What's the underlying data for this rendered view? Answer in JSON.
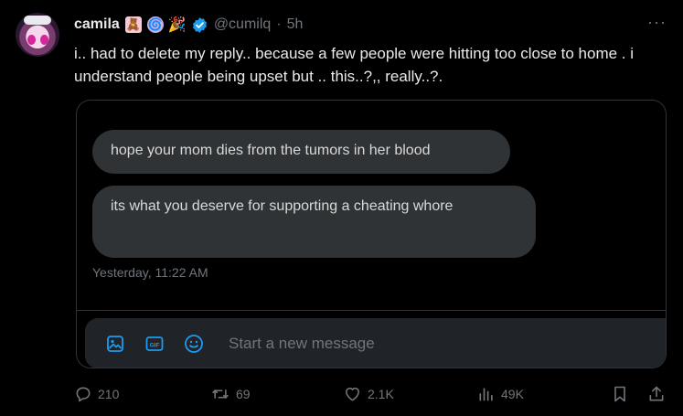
{
  "author": {
    "name": "camila",
    "handle": "@cumilq",
    "separator": "·",
    "time": "5h",
    "emoji": [
      "🧸",
      "🌀",
      "🎉"
    ],
    "verified_color": "#1d9bf0"
  },
  "tweet": {
    "text": "i.. had to delete my reply.. because a few people were hitting too close to home . i understand people being upset but .. this..?,, really..?."
  },
  "dm_screenshot": {
    "messages": [
      "hope your mom dies from the tumors in her blood",
      "its what you deserve for supporting a cheating whore"
    ],
    "timestamp": "Yesterday, 11:22 AM",
    "composer_placeholder": "Start a new message",
    "composer_icons": [
      "image-icon",
      "gif-icon",
      "emoji-icon"
    ],
    "accent_color": "#1d9bf0"
  },
  "actions": {
    "replies": "210",
    "retweets": "69",
    "likes": "2.1K",
    "views": "49K"
  }
}
